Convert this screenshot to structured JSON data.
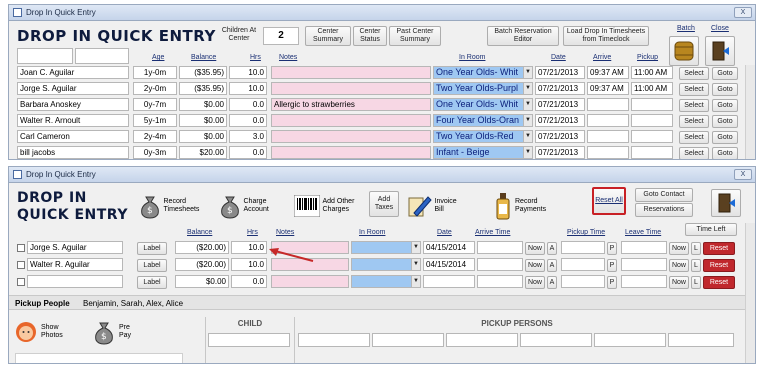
{
  "top": {
    "window_title": "Drop In Quick Entry",
    "heading": "DROP IN QUICK ENTRY",
    "children_label": "Children At Center",
    "children_count": "2",
    "buttons": {
      "center_summary": "Center Summary",
      "center_status": "Center Status",
      "past_center_summary": "Past Center Summary",
      "batch_reservation_editor": "Batch Reservation Editor",
      "load_drop_in": "Load Drop In Timesheets from Timeclock",
      "batch": "Batch",
      "close": "Close"
    },
    "headers": [
      "Age",
      "Balance",
      "Hrs",
      "Notes",
      "In Room",
      "Date",
      "Arrive",
      "Pickup"
    ],
    "rows": [
      {
        "name": "Joan C. Aguilar",
        "age": "1y-0m",
        "balance": "($35.95)",
        "hrs": "10.0",
        "notes": "",
        "room": "One Year Olds- Whit",
        "date": "07/21/2013",
        "arrive": "09:37 AM",
        "pickup": "11:00 AM",
        "select": "Select",
        "goto": "Goto"
      },
      {
        "name": "Jorge S. Aguilar",
        "age": "2y-0m",
        "balance": "($35.95)",
        "hrs": "10.0",
        "notes": "",
        "room": "Two Year Olds-Purpl",
        "date": "07/21/2013",
        "arrive": "09:37 AM",
        "pickup": "11:00 AM",
        "select": "Select",
        "goto": "Goto"
      },
      {
        "name": "Barbara Anoskey",
        "age": "0y-7m",
        "balance": "$0.00",
        "hrs": "0.0",
        "notes": "Allergic to strawberries",
        "room": "One Year Olds- Whit",
        "date": "07/21/2013",
        "arrive": "",
        "pickup": "",
        "select": "Select",
        "goto": "Goto"
      },
      {
        "name": "Walter R. Arnoult",
        "age": "5y-1m",
        "balance": "$0.00",
        "hrs": "0.0",
        "notes": "",
        "room": "Four Year Olds-Oran",
        "date": "07/21/2013",
        "arrive": "",
        "pickup": "",
        "select": "Select",
        "goto": "Goto"
      },
      {
        "name": "Carl Cameron",
        "age": "2y-4m",
        "balance": "$0.00",
        "hrs": "3.0",
        "notes": "",
        "room": "Two Year Olds-Red",
        "date": "07/21/2013",
        "arrive": "",
        "pickup": "",
        "select": "Select",
        "goto": "Goto"
      },
      {
        "name": "bill jacobs",
        "age": "0y-3m",
        "balance": "$20.00",
        "hrs": "0.0",
        "notes": "",
        "room": "Infant - Beige",
        "date": "07/21/2013",
        "arrive": "",
        "pickup": "",
        "select": "Select",
        "goto": "Goto"
      }
    ]
  },
  "bottom": {
    "window_title": "Drop In Quick Entry",
    "heading_line1": "DROP IN",
    "heading_line2": "QUICK ENTRY",
    "toolbar": {
      "record_timesheets": "Record Timesheets",
      "charge_account": "Charge Account",
      "add_other_charges": "Add Other Charges",
      "add_taxes": "Add Taxes",
      "invoice_bill": "Invoice Bill",
      "record_payments": "Record Payments",
      "reset_all": "Reset All",
      "goto_contact": "Goto Contact",
      "reservations": "Reservations",
      "time_left": "Time Left"
    },
    "headers": [
      "Balance",
      "Hrs",
      "Notes",
      "In Room",
      "Date",
      "Arrive Time",
      "Pickup Time",
      "Leave Time"
    ],
    "rows": [
      {
        "checked": false,
        "name": "Jorge S. Aguilar",
        "label": "Label",
        "balance": "($20.00)",
        "hrs": "10.0",
        "date": "04/15/2014",
        "now1": "Now",
        "a": "A",
        "p": "P",
        "now2": "Now",
        "l": "L",
        "reset": "Reset"
      },
      {
        "checked": false,
        "name": "Walter R. Aguilar",
        "label": "Label",
        "balance": "($20.00)",
        "hrs": "10.0",
        "date": "04/15/2014",
        "now1": "Now",
        "a": "A",
        "p": "P",
        "now2": "Now",
        "l": "L",
        "reset": "Reset"
      },
      {
        "checked": false,
        "name": "",
        "label": "Label",
        "balance": "$0.00",
        "hrs": "0.0",
        "date": "",
        "now1": "Now",
        "a": "A",
        "p": "P",
        "now2": "Now",
        "l": "L",
        "reset": "Reset"
      }
    ],
    "pickup_people_label": "Pickup People",
    "pickup_people_value": "Benjamin, Sarah, Alex, Alice",
    "show_photos": "Show Photos",
    "pre_pay": "Pre Pay",
    "child_header": "CHILD",
    "pickup_persons_header": "PICKUP PERSONS"
  }
}
